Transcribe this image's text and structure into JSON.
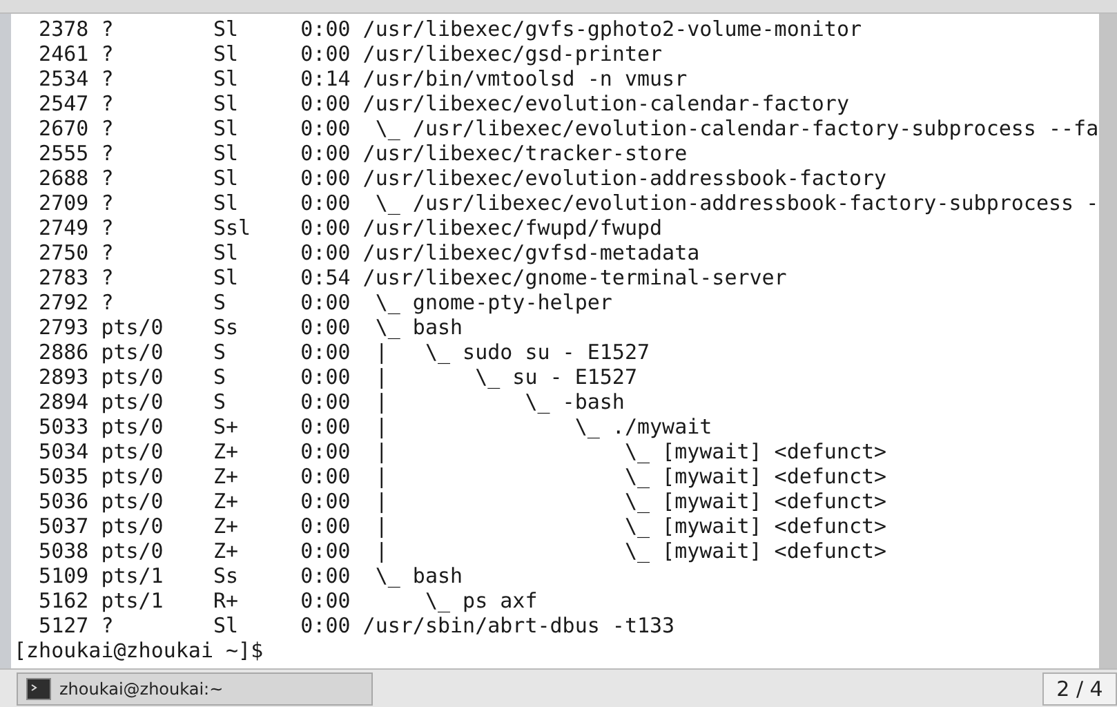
{
  "terminal": {
    "rows": [
      {
        "pid": "2378",
        "tty": "?",
        "stat": "Sl",
        "time": "0:00",
        "command": "/usr/libexec/gvfs-gphoto2-volume-monitor"
      },
      {
        "pid": "2461",
        "tty": "?",
        "stat": "Sl",
        "time": "0:00",
        "command": "/usr/libexec/gsd-printer"
      },
      {
        "pid": "2534",
        "tty": "?",
        "stat": "Sl",
        "time": "0:14",
        "command": "/usr/bin/vmtoolsd -n vmusr"
      },
      {
        "pid": "2547",
        "tty": "?",
        "stat": "Sl",
        "time": "0:00",
        "command": "/usr/libexec/evolution-calendar-factory"
      },
      {
        "pid": "2670",
        "tty": "?",
        "stat": "Sl",
        "time": "0:00",
        "command": " \\_ /usr/libexec/evolution-calendar-factory-subprocess --fa"
      },
      {
        "pid": "2555",
        "tty": "?",
        "stat": "Sl",
        "time": "0:00",
        "command": "/usr/libexec/tracker-store"
      },
      {
        "pid": "2688",
        "tty": "?",
        "stat": "Sl",
        "time": "0:00",
        "command": "/usr/libexec/evolution-addressbook-factory"
      },
      {
        "pid": "2709",
        "tty": "?",
        "stat": "Sl",
        "time": "0:00",
        "command": " \\_ /usr/libexec/evolution-addressbook-factory-subprocess -"
      },
      {
        "pid": "2749",
        "tty": "?",
        "stat": "Ssl",
        "time": "0:00",
        "command": "/usr/libexec/fwupd/fwupd"
      },
      {
        "pid": "2750",
        "tty": "?",
        "stat": "Sl",
        "time": "0:00",
        "command": "/usr/libexec/gvfsd-metadata"
      },
      {
        "pid": "2783",
        "tty": "?",
        "stat": "Sl",
        "time": "0:54",
        "command": "/usr/libexec/gnome-terminal-server"
      },
      {
        "pid": "2792",
        "tty": "?",
        "stat": "S",
        "time": "0:00",
        "command": " \\_ gnome-pty-helper"
      },
      {
        "pid": "2793",
        "tty": "pts/0",
        "stat": "Ss",
        "time": "0:00",
        "command": " \\_ bash"
      },
      {
        "pid": "2886",
        "tty": "pts/0",
        "stat": "S",
        "time": "0:00",
        "command": " |   \\_ sudo su - E1527"
      },
      {
        "pid": "2893",
        "tty": "pts/0",
        "stat": "S",
        "time": "0:00",
        "command": " |       \\_ su - E1527"
      },
      {
        "pid": "2894",
        "tty": "pts/0",
        "stat": "S",
        "time": "0:00",
        "command": " |           \\_ -bash"
      },
      {
        "pid": "5033",
        "tty": "pts/0",
        "stat": "S+",
        "time": "0:00",
        "command": " |               \\_ ./mywait"
      },
      {
        "pid": "5034",
        "tty": "pts/0",
        "stat": "Z+",
        "time": "0:00",
        "command": " |                   \\_ [mywait] <defunct>"
      },
      {
        "pid": "5035",
        "tty": "pts/0",
        "stat": "Z+",
        "time": "0:00",
        "command": " |                   \\_ [mywait] <defunct>"
      },
      {
        "pid": "5036",
        "tty": "pts/0",
        "stat": "Z+",
        "time": "0:00",
        "command": " |                   \\_ [mywait] <defunct>"
      },
      {
        "pid": "5037",
        "tty": "pts/0",
        "stat": "Z+",
        "time": "0:00",
        "command": " |                   \\_ [mywait] <defunct>"
      },
      {
        "pid": "5038",
        "tty": "pts/0",
        "stat": "Z+",
        "time": "0:00",
        "command": " |                   \\_ [mywait] <defunct>"
      },
      {
        "pid": "5109",
        "tty": "pts/1",
        "stat": "Ss",
        "time": "0:00",
        "command": " \\_ bash"
      },
      {
        "pid": "5162",
        "tty": "pts/1",
        "stat": "R+",
        "time": "0:00",
        "command": "     \\_ ps axf"
      },
      {
        "pid": "5127",
        "tty": "?",
        "stat": "Sl",
        "time": "0:00",
        "command": "/usr/sbin/abrt-dbus -t133"
      }
    ],
    "prompt": "[zhoukai@zhoukai ~]$"
  },
  "taskbar": {
    "window_button": "zhoukai@zhoukai:~",
    "workspace": "2 / 4"
  }
}
